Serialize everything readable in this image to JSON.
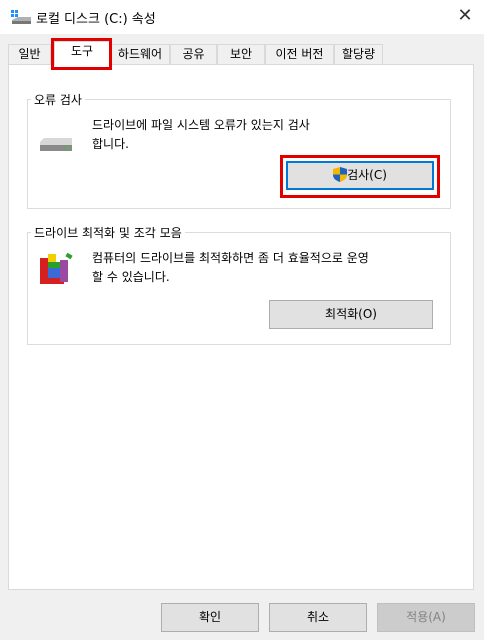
{
  "window": {
    "title": "로컬 디스크 (C:) 속성",
    "close_label": "✕"
  },
  "tabs": [
    {
      "label": "일반"
    },
    {
      "label": "도구"
    },
    {
      "label": "하드웨어"
    },
    {
      "label": "공유"
    },
    {
      "label": "보안"
    },
    {
      "label": "이전 버전"
    },
    {
      "label": "할당량"
    }
  ],
  "selected_tab": "도구",
  "error_check": {
    "title": "오류 검사",
    "description_line1": "드라이브에 파일 시스템 오류가 있는지 검사",
    "description_line2": "합니다.",
    "button": "검사(C)"
  },
  "optimize": {
    "title": "드라이브 최적화 및 조각 모음",
    "description_line1": "컴퓨터의 드라이브를 최적화하면 좀 더 효율적으로 운영",
    "description_line2": "할 수 있습니다.",
    "button": "최적화(O)"
  },
  "footer": {
    "ok": "확인",
    "cancel": "취소",
    "apply": "적용(A)"
  },
  "colors": {
    "highlight": "#e00000",
    "focus": "#0078d7"
  }
}
